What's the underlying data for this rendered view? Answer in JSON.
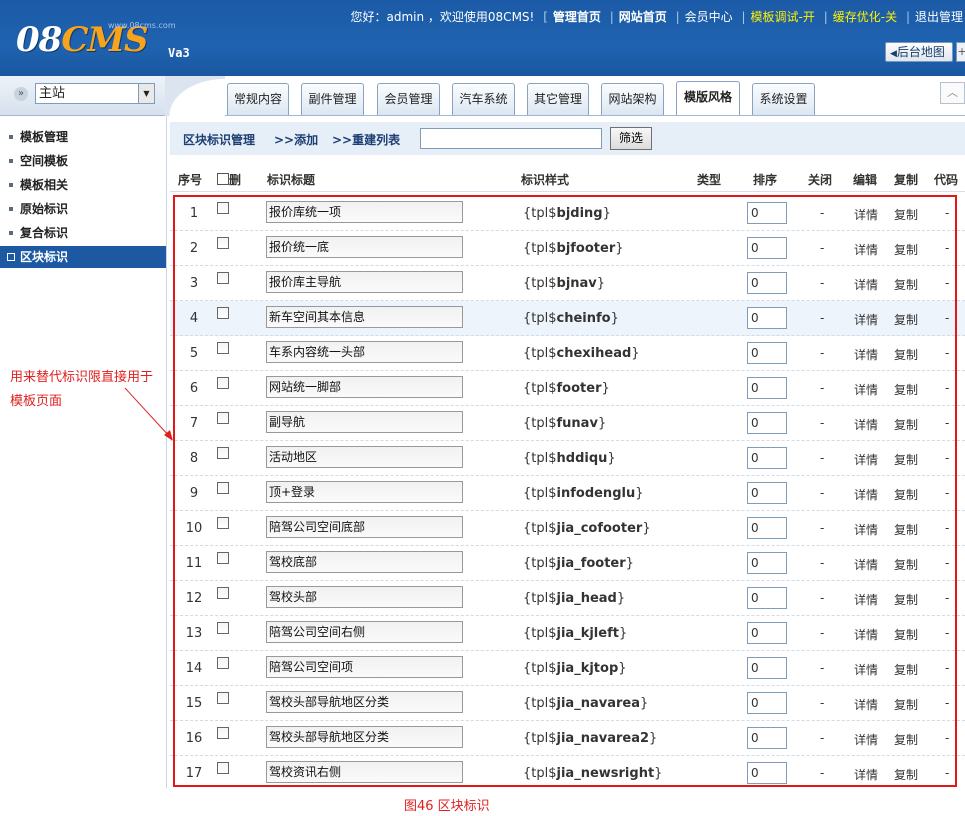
{
  "header": {
    "logo_main": "08",
    "logo_cms": "CMS",
    "logo_sub": "www.08cms.com",
    "version": "Va3",
    "greeting": "您好：admin ，欢迎使用08CMS!",
    "links": [
      {
        "label": "管理首页"
      },
      {
        "label": "网站首页"
      },
      {
        "label": "会员中心"
      },
      {
        "label": "模板调试-开"
      },
      {
        "label": "缓存优化-关"
      },
      {
        "label": "退出管理"
      }
    ],
    "backmap_label": "后台地图",
    "backmap_plus": "+"
  },
  "site_selector": {
    "value": "主站"
  },
  "tabs": [
    {
      "label": "常规内容"
    },
    {
      "label": "副件管理"
    },
    {
      "label": "会员管理"
    },
    {
      "label": "汽车系统"
    },
    {
      "label": "其它管理"
    },
    {
      "label": "网站架构"
    },
    {
      "label": "模版风格"
    },
    {
      "label": "系统设置"
    }
  ],
  "sidebar": {
    "items": [
      {
        "label": "模板管理"
      },
      {
        "label": "空间模板"
      },
      {
        "label": "模板相关"
      },
      {
        "label": "原始标识"
      },
      {
        "label": "复合标识"
      },
      {
        "label": "区块标识"
      }
    ],
    "annotation": "用来替代标识限直接用于模板页面"
  },
  "toolbar": {
    "title": "区块标识管理",
    "add": ">>添加",
    "rebuild": ">>重建列表",
    "filter_value": "",
    "filter_button": "筛选"
  },
  "table": {
    "headers": {
      "num": "序号",
      "select": "删",
      "title": "标识标题",
      "style": "标识样式",
      "type": "类型",
      "order": "排序",
      "close": "关闭",
      "edit": "编辑",
      "copy": "复制",
      "code": "代码"
    },
    "rows": [
      {
        "num": "1",
        "title": "报价库统一项",
        "style_pre": "{tpl$",
        "style_name": "bjding",
        "style_post": "}",
        "order": "0",
        "close": "-",
        "edit": "详情",
        "copy": "复制",
        "code": "-"
      },
      {
        "num": "2",
        "title": "报价统一底",
        "style_pre": "{tpl$",
        "style_name": "bjfooter",
        "style_post": "}",
        "order": "0",
        "close": "-",
        "edit": "详情",
        "copy": "复制",
        "code": "-"
      },
      {
        "num": "3",
        "title": "报价库主导航",
        "style_pre": "{tpl$",
        "style_name": "bjnav",
        "style_post": "}",
        "order": "0",
        "close": "-",
        "edit": "详情",
        "copy": "复制",
        "code": "-"
      },
      {
        "num": "4",
        "title": "新车空间其本信息",
        "style_pre": "{tpl$",
        "style_name": "cheinfo",
        "style_post": "}",
        "order": "0",
        "close": "-",
        "edit": "详情",
        "copy": "复制",
        "code": "-"
      },
      {
        "num": "5",
        "title": "车系内容统一头部",
        "style_pre": "{tpl$",
        "style_name": "chexihead",
        "style_post": "}",
        "order": "0",
        "close": "-",
        "edit": "详情",
        "copy": "复制",
        "code": "-"
      },
      {
        "num": "6",
        "title": "网站统一脚部",
        "style_pre": "{tpl$",
        "style_name": "footer",
        "style_post": "}",
        "order": "0",
        "close": "-",
        "edit": "详情",
        "copy": "复制",
        "code": "-"
      },
      {
        "num": "7",
        "title": "副导航",
        "style_pre": "{tpl$",
        "style_name": "funav",
        "style_post": "}",
        "order": "0",
        "close": "-",
        "edit": "详情",
        "copy": "复制",
        "code": "-"
      },
      {
        "num": "8",
        "title": "活动地区",
        "style_pre": "{tpl$",
        "style_name": "hddiqu",
        "style_post": "}",
        "order": "0",
        "close": "-",
        "edit": "详情",
        "copy": "复制",
        "code": "-"
      },
      {
        "num": "9",
        "title": "顶+登录",
        "style_pre": "{tpl$",
        "style_name": "infodenglu",
        "style_post": "}",
        "order": "0",
        "close": "-",
        "edit": "详情",
        "copy": "复制",
        "code": "-"
      },
      {
        "num": "10",
        "title": "陪驾公司空间底部",
        "style_pre": "{tpl$",
        "style_name": "jia_cofooter",
        "style_post": "}",
        "order": "0",
        "close": "-",
        "edit": "详情",
        "copy": "复制",
        "code": "-"
      },
      {
        "num": "11",
        "title": "驾校底部",
        "style_pre": "{tpl$",
        "style_name": "jia_footer",
        "style_post": "}",
        "order": "0",
        "close": "-",
        "edit": "详情",
        "copy": "复制",
        "code": "-"
      },
      {
        "num": "12",
        "title": "驾校头部",
        "style_pre": "{tpl$",
        "style_name": "jia_head",
        "style_post": "}",
        "order": "0",
        "close": "-",
        "edit": "详情",
        "copy": "复制",
        "code": "-"
      },
      {
        "num": "13",
        "title": "陪驾公司空间右侧",
        "style_pre": "{tpl$",
        "style_name": "jia_kjleft",
        "style_post": "}",
        "order": "0",
        "close": "-",
        "edit": "详情",
        "copy": "复制",
        "code": "-"
      },
      {
        "num": "14",
        "title": "陪驾公司空间项",
        "style_pre": "{tpl$",
        "style_name": "jia_kjtop",
        "style_post": "}",
        "order": "0",
        "close": "-",
        "edit": "详情",
        "copy": "复制",
        "code": "-"
      },
      {
        "num": "15",
        "title": "驾校头部导航地区分类",
        "style_pre": "{tpl$",
        "style_name": "jia_navarea",
        "style_post": "}",
        "order": "0",
        "close": "-",
        "edit": "详情",
        "copy": "复制",
        "code": "-"
      },
      {
        "num": "16",
        "title": "驾校头部导航地区分类",
        "style_pre": "{tpl$",
        "style_name": "jia_navarea2",
        "style_post": "}",
        "order": "0",
        "close": "-",
        "edit": "详情",
        "copy": "复制",
        "code": "-"
      },
      {
        "num": "17",
        "title": "驾校资讯右侧",
        "style_pre": "{tpl$",
        "style_name": "jia_newsright",
        "style_post": "}",
        "order": "0",
        "close": "-",
        "edit": "详情",
        "copy": "复制",
        "code": "-"
      }
    ]
  },
  "caption": "图46 区块标识",
  "colors": {
    "header_blue": "#1f63b0",
    "active_blue": "#1c59a2",
    "highlight_yellow": "#fff200",
    "annotation_red": "#e02020"
  }
}
